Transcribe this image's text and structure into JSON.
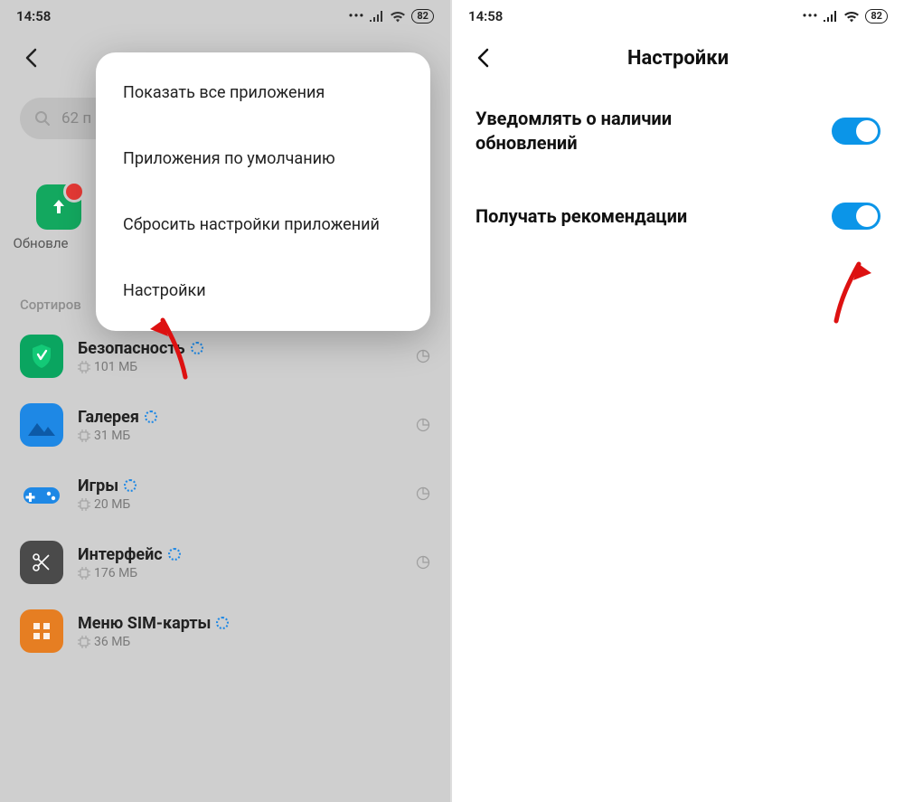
{
  "statusbar": {
    "time": "14:58",
    "battery": "82"
  },
  "left": {
    "search_text": "62 п",
    "updates_label": "Обновле",
    "sort_label": "Сортиров",
    "popup": {
      "items": [
        "Показать все приложения",
        "Приложения по умолчанию",
        "Сбросить настройки приложений",
        "Настройки"
      ]
    },
    "apps": [
      {
        "name": "Безопасность",
        "size": "101 МБ"
      },
      {
        "name": "Галерея",
        "size": "31 МБ"
      },
      {
        "name": "Игры",
        "size": "20 МБ"
      },
      {
        "name": "Интерфейс",
        "size": "176 МБ"
      },
      {
        "name": "Меню SIM-карты",
        "size": "36 МБ"
      }
    ]
  },
  "right": {
    "title": "Настройки",
    "settings": [
      {
        "label": "Уведомлять о наличии обновлений",
        "on": true
      },
      {
        "label": "Получать рекомендации",
        "on": true
      }
    ]
  }
}
